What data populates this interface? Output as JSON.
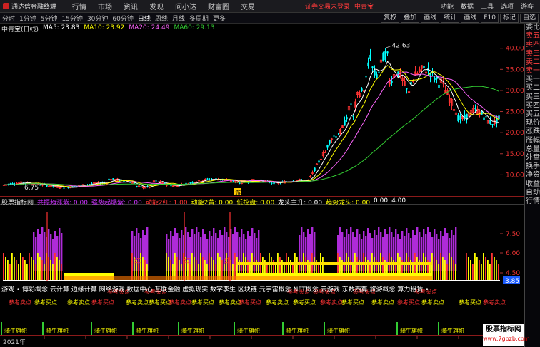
{
  "topbar": {
    "app_name": "通达信金融终端",
    "menu": [
      "行情",
      "市场",
      "资讯",
      "发现",
      "问小达",
      "财富圈",
      "交易"
    ],
    "notice": "证券交易未登录",
    "notice_stock": "中青宝",
    "right_menu": [
      "功能",
      "数据",
      "工具",
      "选项",
      "游客"
    ]
  },
  "tabbar": {
    "tabs": [
      "分时",
      "1分钟",
      "5分钟",
      "15分钟",
      "30分钟",
      "60分钟",
      "日线",
      "周线",
      "月线",
      "多周期",
      "更多"
    ],
    "active_tab": "日线",
    "tools": [
      "复权",
      "叠加",
      "画线",
      "统计",
      "画线",
      "F10",
      "标记",
      "自选"
    ]
  },
  "chart_head": {
    "stock": "中青宝(日线)",
    "ma5": "MA5: 23.83",
    "ma10": "MA10: 23.92",
    "ma20": "MA20: 24.49",
    "ma60": "MA60: 29.13"
  },
  "colors": {
    "ma5": "#ffffff",
    "ma10": "#ffff00",
    "ma20": "#ff66ff",
    "ma60": "#33cc33",
    "up": "#ff3333",
    "down": "#00ffff",
    "magenta": "#cc33ff",
    "yellow": "#ffff00"
  },
  "right_panel": {
    "labels": [
      "委比",
      "卖五",
      "卖四",
      "卖三",
      "卖二",
      "卖一",
      "买一",
      "买二",
      "买三",
      "买四",
      "买五",
      "现价",
      "涨跌",
      "涨幅",
      "总量",
      "外盘",
      "换手",
      "净资",
      "收益",
      "自动",
      "行情"
    ]
  },
  "price_axis": {
    "ticks": [
      "40.00",
      "35.00",
      "30.00",
      "25.00",
      "20.00",
      "15.00",
      "10.00"
    ]
  },
  "annotations": {
    "high": "42.63",
    "low": "6.75",
    "marker": "游"
  },
  "indicator_head": {
    "name": "股票指标网",
    "items": [
      {
        "text": "共振趋涨紫: 0.00",
        "color": "#cc33ff"
      },
      {
        "text": "强势起爆紫: 0.00",
        "color": "#cc33ff"
      },
      {
        "text": "动能2红: 1.00",
        "color": "#ff3333"
      },
      {
        "text": "动能2黄: 0.00",
        "color": "#ffff00"
      },
      {
        "text": "低控盘: 0.00",
        "color": "#ffff00"
      },
      {
        "text": "龙头主升: 0.00",
        "color": "#ffffff"
      },
      {
        "text": "趋势龙头: 0.00",
        "color": "#ffff00"
      },
      {
        "text": "0.00",
        "color": "#ffffff"
      },
      {
        "text": "4.00",
        "color": "#ffffff"
      }
    ]
  },
  "indicator_axis": {
    "ticks": [
      "7.50",
      "6.00",
      "4.50",
      "3.85"
    ]
  },
  "concepts": "游戏 • 博彩概念 云计算 边缘计算 网络游戏 数据中心 互联金融 虚拟现实 数字孪生 区块链 元宇宙概念 NFT概念 云游戏 东数西算 旅游概念 算力租赁 •",
  "chart_labels": {
    "hong": "红",
    "ref_buy": "参考买点",
    "ref_sell": "参考卖点",
    "ride": "骑牛",
    "flag": "旗帜"
  },
  "date_axis": {
    "start": "2021年"
  },
  "watermark": {
    "title": "股票指标网",
    "url": "www.7gpzb.com"
  }
}
